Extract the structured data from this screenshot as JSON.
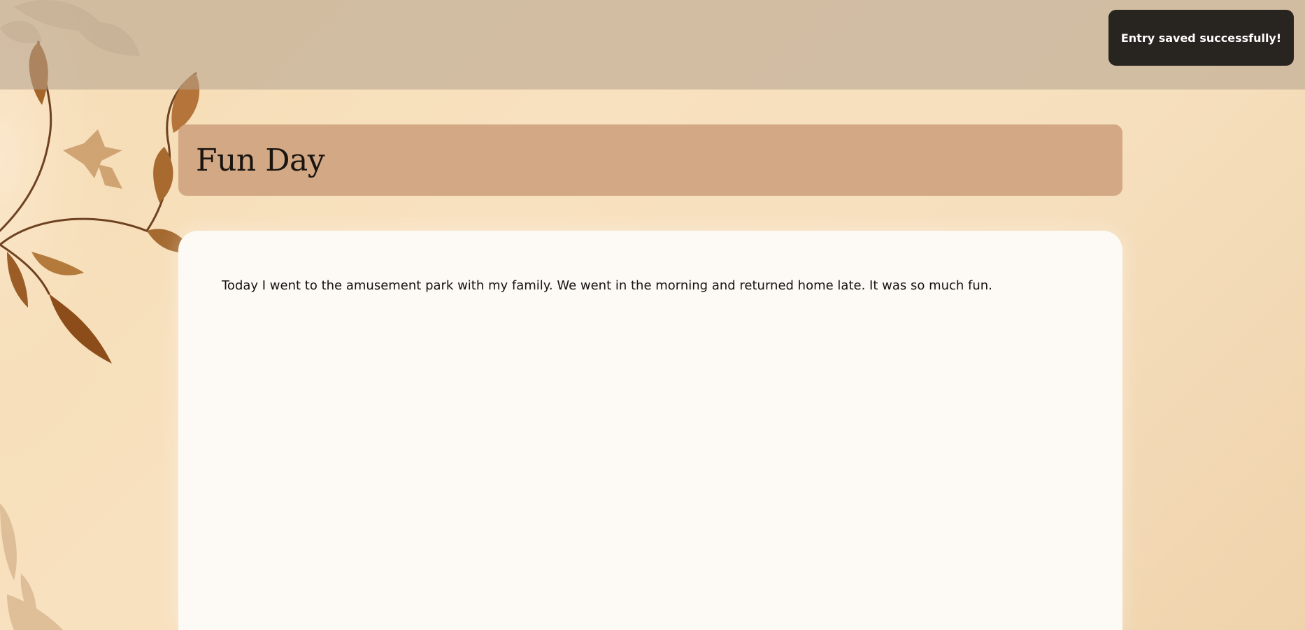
{
  "toast": {
    "message": "Entry saved successfully!"
  },
  "entry": {
    "title": "Fun Day",
    "content": "Today I went to the amusement park with my family. We went in the morning and returned home late. It was so much fun."
  },
  "colors": {
    "background": "#f7dfbb",
    "top_band": "#c8b39a",
    "toast_background": "#28241f",
    "title_card": "#d3a985",
    "content_card": "#fdfaf5",
    "leaf": "#9a5a22"
  },
  "decorations": {
    "background_art": "botanical-leaf-branch"
  }
}
